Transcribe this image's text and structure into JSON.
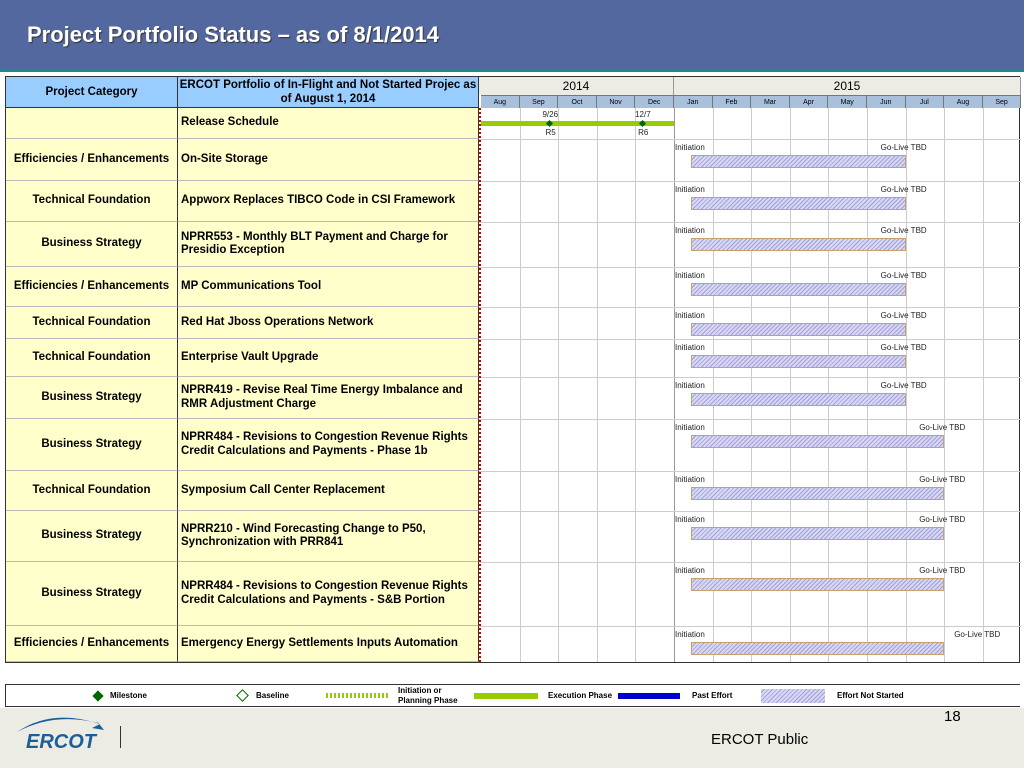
{
  "title": "Project Portfolio Status – as of 8/1/2014",
  "table": {
    "col_category": "Project Category",
    "col_project": "ERCOT Portfolio of In-Flight and Not Started Projec as of August 1, 2014",
    "years": [
      "2014",
      "2015"
    ],
    "months": [
      "Aug",
      "Sep",
      "Oct",
      "Nov",
      "Dec",
      "Jan",
      "Feb",
      "Mar",
      "Apr",
      "May",
      "Jun",
      "Jul",
      "Aug",
      "Sep"
    ],
    "release": {
      "category": "",
      "name": "Release Schedule",
      "milestones": [
        {
          "date": "9/26",
          "label": "R5",
          "month_pos": 1.8
        },
        {
          "date": "12/7",
          "label": "R6",
          "month_pos": 4.2
        }
      ],
      "execution_end_month_pos": 5.0
    },
    "rows": [
      {
        "category": "Efficiencies / Enhancements",
        "name": "On-Site Storage",
        "start_label": "Initiation",
        "end_label": "Go-Live TBD",
        "bar_start": "Jan 2015",
        "bar_end": "Jun 2015"
      },
      {
        "category": "Technical Foundation",
        "name": "Appworx Replaces TIBCO Code in CSI Framework",
        "start_label": "Initiation",
        "end_label": "Go-Live TBD",
        "bar_start": "Jan 2015",
        "bar_end": "Jun 2015"
      },
      {
        "category": "Business Strategy",
        "name": "NPRR553 - Monthly BLT Payment and Charge for Presidio Exception",
        "start_label": "Initiation",
        "end_label": "Go-Live TBD",
        "bar_start": "Jan 2015",
        "bar_end": "Jun 2015"
      },
      {
        "category": "Efficiencies / Enhancements",
        "name": "MP Communications Tool",
        "start_label": "Initiation",
        "end_label": "Go-Live TBD",
        "bar_start": "Jan 2015",
        "bar_end": "Jun 2015"
      },
      {
        "category": "Technical Foundation",
        "name": "Red Hat Jboss Operations Network",
        "start_label": "Initiation",
        "end_label": "Go-Live TBD",
        "bar_start": "Jan 2015",
        "bar_end": "Jun 2015"
      },
      {
        "category": "Technical Foundation",
        "name": "Enterprise Vault Upgrade",
        "start_label": "Initiation",
        "end_label": "Go-Live TBD",
        "bar_start": "Jan 2015",
        "bar_end": "Jun 2015"
      },
      {
        "category": "Business Strategy",
        "name": "NPRR419 - Revise Real Time Energy Imbalance and RMR Adjustment Charge",
        "start_label": "Initiation",
        "end_label": "Go-Live TBD",
        "bar_start": "Jan 2015",
        "bar_end": "Jun 2015"
      },
      {
        "category": "Business Strategy",
        "name": "NPRR484 - Revisions to Congestion Revenue Rights Credit Calculations and Payments - Phase 1b",
        "start_label": "Initiation",
        "end_label": "Go-Live TBD",
        "bar_start": "Jan 2015",
        "bar_end": "Jul 2015"
      },
      {
        "category": "Technical Foundation",
        "name": "Symposium Call Center Replacement",
        "start_label": "Initiation",
        "end_label": "Go-Live TBD",
        "bar_start": "Jan 2015",
        "bar_end": "Jul 2015"
      },
      {
        "category": "Business Strategy",
        "name": "NPRR210 - Wind Forecasting Change to P50, Synchronization with PRR841",
        "start_label": "Initiation",
        "end_label": "Go-Live TBD",
        "bar_start": "Jan 2015",
        "bar_end": "Jul 2015"
      },
      {
        "category": "Business Strategy",
        "name": "NPRR484 - Revisions to Congestion Revenue Rights Credit Calculations and Payments - S&B Portion",
        "start_label": "Initiation",
        "end_label": "Go-Live TBD",
        "bar_start": "Jan 2015",
        "bar_end": "Jul 2015"
      },
      {
        "category": "Efficiencies / Enhancements",
        "name": "Emergency Energy Settlements Inputs Automation",
        "start_label": "Initiation",
        "end_label": "Go-Live TBD",
        "bar_start": "Jan 2015",
        "bar_end": "Jul 2015"
      }
    ]
  },
  "legend": {
    "milestone": "Milestone",
    "baseline": "Baseline",
    "initiation": "Initiation or Planning Phase",
    "execution": "Execution Phase",
    "past": "Past Effort",
    "not_started": "Effort Not Started"
  },
  "colors": {
    "title_bg": "#5468a0",
    "execution": "#99cc00",
    "past": "#0000cc",
    "milestone": "#006600"
  },
  "footer": {
    "page": "18",
    "classification": "ERCOT Public",
    "logo": "ERCOT"
  }
}
